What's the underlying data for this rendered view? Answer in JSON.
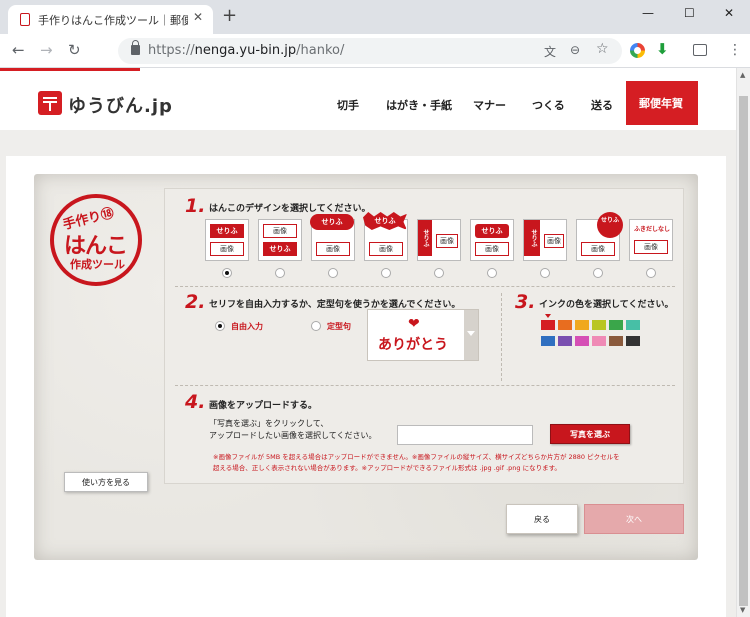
{
  "browser": {
    "tab_title": "手作りはんこ作成ツール｜郵便年賀",
    "tab_close": "✕",
    "new_tab": "+",
    "window_minimize": "—",
    "window_maximize": "☐",
    "window_close": "✕",
    "back": "←",
    "forward": "→",
    "reload": "↻",
    "url_scheme": "https://",
    "url_host": "nenga.yu-bin.jp",
    "url_path": "/hanko/",
    "translate_icon": "文",
    "zoom_icon": "⊖",
    "bookmark_icon": "☆",
    "download_icon": "⬇",
    "menu_icon": "⋮",
    "scroll_up": "▲",
    "scroll_down": "▼"
  },
  "site": {
    "logo_text": "ゆうびん.jp",
    "nav": [
      "切手",
      "はがき・手紙",
      "マナー",
      "つくる",
      "送る"
    ],
    "nav_active": "郵便年賀"
  },
  "stamp": {
    "line1": "手作り⑱",
    "line2": "はんこ",
    "line3": "作成ツール"
  },
  "step1": {
    "number": "1.",
    "label": "はんこのデザインを選択してください。",
    "designs": [
      {
        "serif": "せりふ",
        "image": "画像",
        "selected": true
      },
      {
        "serif": "せりふ",
        "image": "画像",
        "selected": false
      },
      {
        "serif": "せりふ",
        "image": "画像",
        "selected": false
      },
      {
        "serif": "せりふ",
        "image": "画像",
        "selected": false
      },
      {
        "serif": "せりふ",
        "image": "画像",
        "selected": false
      },
      {
        "serif": "せりふ",
        "image": "画像",
        "selected": false
      },
      {
        "serif": "せりふ",
        "image": "画像",
        "selected": false
      },
      {
        "serif": "せりふ",
        "image": "画像",
        "selected": false
      },
      {
        "serif": "ふきだしなし",
        "image": "画像",
        "selected": false
      }
    ]
  },
  "step2": {
    "number": "2.",
    "label": "セリフを自由入力するか、定型句を使うかを選んでください。",
    "option_free": "自由入力",
    "option_fixed": "定型句",
    "phrase": "ありがとう",
    "phrase_heart": "❤"
  },
  "step3": {
    "number": "3.",
    "label": "インクの色を選択してください。",
    "colors_row1": [
      "#d51e23",
      "#e86d1f",
      "#f0a81d",
      "#b9c623",
      "#3aa64a",
      "#47bfa6"
    ],
    "colors_row2": [
      "#2f6fc0",
      "#7a4fb0",
      "#d54fb5",
      "#ef8ab5",
      "#8a5a3c",
      "#333333"
    ]
  },
  "step4": {
    "number": "4.",
    "label": "画像をアップロードする。",
    "desc1": "「写真を選ぶ」をクリックして、",
    "desc2": "アップロードしたい画像を選択してください。",
    "input_value": "",
    "button": "写真を選ぶ",
    "notice1": "※画像ファイルが 5MB を超える場合はアップロードができません。※画像ファイルの縦サイズ、横サイズどちらか片方が 2880 ピクセルを",
    "notice2": "超える場合、正しく表示されない場合があります。※アップロードができるファイル形式は .jpg .gif .png になります。"
  },
  "buttons": {
    "howto": "使い方を見る",
    "back": "戻る",
    "next": "次へ"
  }
}
